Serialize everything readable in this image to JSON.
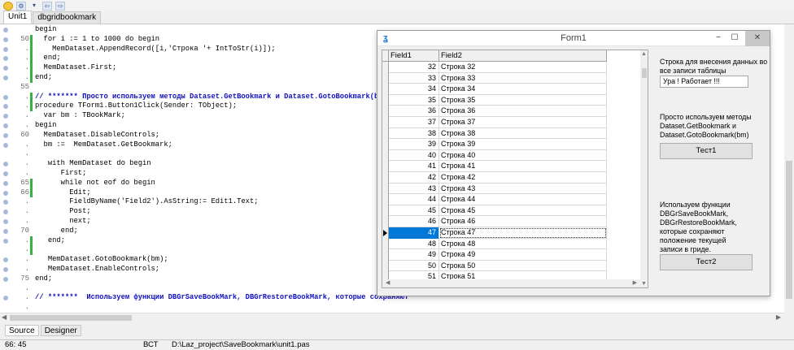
{
  "tabs": [
    "Unit1",
    "dbgridbookmark"
  ],
  "gutter": [
    {
      "n": "",
      "dot": true
    },
    {
      "n": "50",
      "dot": true
    },
    {
      "n": ".",
      "dot": true
    },
    {
      "n": ".",
      "dot": true
    },
    {
      "n": ".",
      "dot": true
    },
    {
      "n": ".",
      "dot": true
    },
    {
      "n": "55",
      "dot": false
    },
    {
      "n": ".",
      "dot": true
    },
    {
      "n": ".",
      "dot": true
    },
    {
      "n": ".",
      "dot": true
    },
    {
      "n": ".",
      "dot": true
    },
    {
      "n": "60",
      "dot": true
    },
    {
      "n": ".",
      "dot": true
    },
    {
      "n": ".",
      "dot": false
    },
    {
      "n": ".",
      "dot": true
    },
    {
      "n": ".",
      "dot": true
    },
    {
      "n": "65",
      "dot": true
    },
    {
      "n": "66",
      "dot": true
    },
    {
      "n": ".",
      "dot": true
    },
    {
      "n": ".",
      "dot": true
    },
    {
      "n": ".",
      "dot": true
    },
    {
      "n": "70",
      "dot": true
    },
    {
      "n": ".",
      "dot": true
    },
    {
      "n": ".",
      "dot": false
    },
    {
      "n": ".",
      "dot": true
    },
    {
      "n": ".",
      "dot": true
    },
    {
      "n": "75",
      "dot": true
    },
    {
      "n": ".",
      "dot": false
    },
    {
      "n": ".",
      "dot": true
    },
    {
      "n": ".",
      "dot": false
    }
  ],
  "code": [
    "begin",
    "  for i := 1 to 1000 do begin",
    "    MemDataset.AppendRecord([i,'Строка '+ IntToStr(i)]);",
    "  end;",
    "  MemDataset.First;",
    "end;",
    "",
    "// ******* Просто используем методы Dataset.GetBookmark и Dataset.GotoBookmark(bm)",
    "procedure TForm1.Button1Click(Sender: TObject);",
    "  var bm : TBookMark;",
    "begin",
    "  MemDataset.DisableControls;",
    "  bm :=  MemDataset.GetBookmark;",
    "",
    "   with MemDataset do begin",
    "      First;",
    "      while not eof do begin",
    "        Edit;",
    "        FieldByName('Field2').AsString:= Edit1.Text;",
    "        Post;",
    "        next;",
    "      end;",
    "   end;",
    "",
    "   MemDataset.GotoBookmark(bm);",
    "   MemDataset.EnableControls;",
    "end;",
    "",
    "// *******  Используем функции DBGrSaveBookMark, DBGrRestoreBookMark, которые сохраняют",
    ""
  ],
  "bottom_tabs": [
    "Source",
    "Designer"
  ],
  "status": {
    "position": "66: 45",
    "mode": "ВСТ",
    "file": "D:\\Laz_project\\SaveBookmark\\unit1.pas"
  },
  "form": {
    "title": "Form1",
    "minimize": "−",
    "maximize": "☐",
    "close": "✕",
    "columns": [
      "Field1",
      "Field2"
    ],
    "rows": [
      {
        "f1": "32",
        "f2": "Строка 32"
      },
      {
        "f1": "33",
        "f2": "Строка 33"
      },
      {
        "f1": "34",
        "f2": "Строка 34"
      },
      {
        "f1": "35",
        "f2": "Строка 35"
      },
      {
        "f1": "36",
        "f2": "Строка 36"
      },
      {
        "f1": "37",
        "f2": "Строка 37"
      },
      {
        "f1": "38",
        "f2": "Строка 38"
      },
      {
        "f1": "39",
        "f2": "Строка 39"
      },
      {
        "f1": "40",
        "f2": "Строка 40"
      },
      {
        "f1": "41",
        "f2": "Строка 41"
      },
      {
        "f1": "42",
        "f2": "Строка 42"
      },
      {
        "f1": "43",
        "f2": "Строка 43"
      },
      {
        "f1": "44",
        "f2": "Строка 44"
      },
      {
        "f1": "45",
        "f2": "Строка 45"
      },
      {
        "f1": "46",
        "f2": "Строка 46"
      },
      {
        "f1": "47",
        "f2": "Строка 47"
      },
      {
        "f1": "48",
        "f2": "Строка 48"
      },
      {
        "f1": "49",
        "f2": "Строка 49"
      },
      {
        "f1": "50",
        "f2": "Строка 50"
      },
      {
        "f1": "51",
        "f2": "Строка 51"
      }
    ],
    "selected_row": "47",
    "label1": [
      "Строка  для внесения данных во",
      "все записи таблицы"
    ],
    "edit1_value": "Ура ! Работает !!!",
    "label2": [
      "Просто используем методы",
      "Dataset.GetBookmark и",
      "Dataset.GotoBookmark(bm)"
    ],
    "button1": "Тест1",
    "label3": [
      "Используем функции",
      "DBGrSaveBookMark,",
      "DBGrRestoreBookMark,",
      "которые сохраняют",
      "положение  текущей",
      "записи в гриде."
    ],
    "button2": "Тест2"
  }
}
